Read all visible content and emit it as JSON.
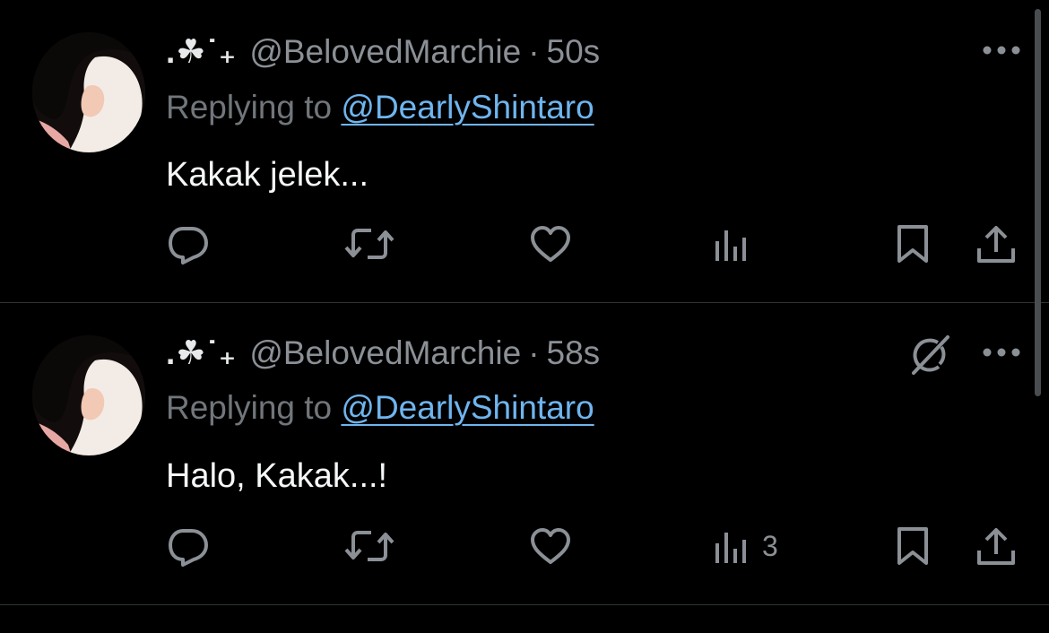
{
  "colors": {
    "background": "#000000",
    "text": "#e7e9ea",
    "secondary": "#71767b",
    "link": "#6fb5ef",
    "divider": "#2f3336"
  },
  "tweets": [
    {
      "display_name": ".☘︎˙₊",
      "handle": "@BelovedMarchie",
      "separator": "·",
      "time": "50s",
      "replying_prefix": "Replying to",
      "replying_to": "@DearlyShintaro",
      "text": "Kakak jelek...",
      "views_count": "",
      "icons": [
        "reply-icon",
        "retweet-icon",
        "like-icon",
        "views-icon",
        "bookmark-icon",
        "share-icon",
        "more-icon"
      ]
    },
    {
      "display_name": ".☘︎˙₊",
      "handle": "@BelovedMarchie",
      "separator": "·",
      "time": "58s",
      "replying_prefix": "Replying to",
      "replying_to": "@DearlyShintaro",
      "text": "Halo, Kakak...!",
      "views_count": "3",
      "icons": [
        "grok-icon",
        "reply-icon",
        "retweet-icon",
        "like-icon",
        "views-icon",
        "bookmark-icon",
        "share-icon",
        "more-icon"
      ]
    }
  ]
}
